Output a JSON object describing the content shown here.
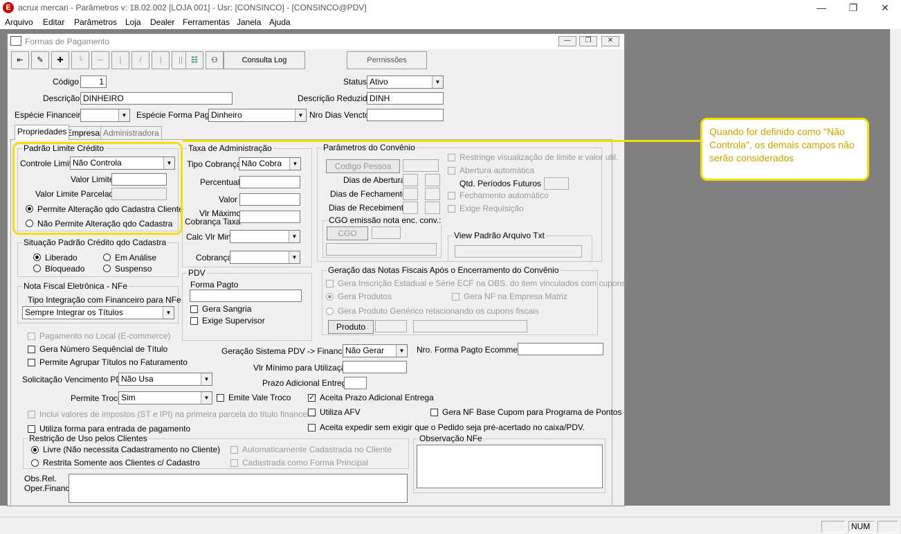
{
  "window": {
    "title": "acrux mercari - Parâmetros  v: 18.02.002   [LOJA 001]  - Usr: [CONSINCO] - [CONSINCO@PDV]",
    "app_icon": "E"
  },
  "menu": [
    "Arquivo",
    "Editar",
    "Parâmetros",
    "Loja",
    "Dealer",
    "Ferramentas",
    "Janela",
    "Ajuda"
  ],
  "child": {
    "title": "Formas de Pagamento"
  },
  "toolbar": {
    "consulta_log": "Consulta Log",
    "permissoes": "Permissões"
  },
  "header": {
    "codigo_label": "Código",
    "codigo": "1",
    "status_label": "Status",
    "status": "Ativo",
    "descricao_label": "Descrição",
    "descricao": "DINHEIRO",
    "desc_reduzida_label": "Descrição Reduzida",
    "desc_reduzida": "DINH",
    "especie_fin_label": "Espécie Financeira",
    "especie_fin": "",
    "especie_forma_label": "Espécie Forma Pagto",
    "especie_forma": "Dinheiro",
    "nro_dias_label": "Nro Dias Vencto",
    "nro_dias": ""
  },
  "tabs": [
    "Propriedades",
    "Empresas",
    "Administradora"
  ],
  "limite": {
    "title": "Padrão Limite Crédito",
    "controle_label": "Controle Limite",
    "controle": "Não Controla",
    "valor_label": "Valor Limite",
    "parcelado_label": "Valor Limite Parcelado",
    "opt1": "Permite Alteração qdo Cadastra Cliente",
    "opt2": "Não Permite Alteração qdo Cadastra"
  },
  "situacao": {
    "title": "Situação Padrão Crédito qdo Cadastra",
    "liberado": "Liberado",
    "analise": "Em Análise",
    "bloqueado": "Bloqueado",
    "suspenso": "Suspenso"
  },
  "nfe": {
    "title": "Nota Fiscal Eletrônica - NFe",
    "tipo_label": "Tipo Integração com Financeiro para NFe",
    "tipo": "Sempre Integrar os Títulos"
  },
  "taxa": {
    "title": "Taxa de Administração",
    "tipo_cob_label": "Tipo Cobrança",
    "tipo_cob": "Não Cobra",
    "percentual_label": "Percentual",
    "valor_label": "Valor",
    "vlr_max_label1": "Vlr Máximo",
    "vlr_max_label2": "Cobrança Taxa",
    "calc_label": "Calc Vlr Min",
    "cobranca_label": "Cobrança"
  },
  "pdv": {
    "title": "PDV",
    "forma_label": "Forma Pagto",
    "gera_sangria": "Gera Sangria",
    "exige_sup": "Exige Supervisor"
  },
  "convenio": {
    "title": "Parâmetros do Convênio",
    "codigo_pessoa": "Codigo Pessoa",
    "dias_abertura": "Dias de Abertura",
    "dias_fechamento": "Dias de Fechamento",
    "dias_recebimento": "Dias de Recebimento",
    "restringe": "Restringe visualização de limite e valor util.",
    "abertura_auto": "Abertura automática",
    "qtd_periodos": "Qtd. Períodos Futuros",
    "fechamento_auto": "Fechamento automático",
    "exige_req": "Exige Requisição",
    "cgo_title": "CGO emissão nota enc. conv.:",
    "cgo_btn": "CGO",
    "view_title": "View Padrão Arquivo Txt"
  },
  "geracao": {
    "title": "Geração das Notas Fiscais Após o Encerramento do Convênio",
    "gera_insc": "Gera Inscrição Estadual e Série ECF na OBS. do item vinculados com cupons",
    "gera_produtos": "Gera Produtos",
    "gera_nf_matriz": "Gera NF na Empresa Matriz",
    "gera_generico": "Gera Produto Genérico relacionando os cupons fiscais",
    "produto_btn": "Produto"
  },
  "opts": {
    "pag_local": "Pagamento no Local (E-commerce)",
    "gera_num": "Gera Número Sequêncial de Título",
    "permite_agrupar": "Permite Agrupar Títulos no Faturamento",
    "solic_label": "Solicitação Vencimento PDV",
    "solic": "Não Usa",
    "troco_label": "Permite Troco",
    "troco": "Sim",
    "emite_vale": "Emite Vale Troco",
    "inclui_impostos": "Inclui valores de impostos (ST e IPI) na primeira parcela do título financeiro",
    "utiliza_entrada": "Utiliza forma para entrada de pagamento",
    "geracao_pdv_label": "Geração Sistema PDV -> Financeiro",
    "geracao_pdv": "Não Gerar",
    "nro_forma_label": "Nro. Forma Pagto Ecommerce",
    "vlr_min_label": "Vlr Mínimo para Utilização",
    "prazo_label": "Prazo Adicional Entrega",
    "aceita_prazo": "Aceita Prazo Adicional Entrega",
    "utiliza_afv": "Utiliza AFV",
    "gera_nf_base": "Gera NF Base Cupom para Programa de Pontos",
    "aceita_expedir": "Aceita expedir sem exigir que o Pedido seja pré-acertado no caixa/PDV."
  },
  "restricao": {
    "title": "Restrição de Uso pelos Clientes",
    "livre": "Livre (Não necessita Cadastramento no Cliente)",
    "restrita": "Restrita Somente aos Clientes c/ Cadastro",
    "auto_cad": "Automaticamente Cadastrada no Cliente",
    "cad_principal": "Cadastrada como Forma Principal"
  },
  "obs": {
    "nfe_title": "Observação NFe",
    "rel_label1": "Obs.Rel.",
    "rel_label2": "Oper.Financ."
  },
  "callout": {
    "text": "Quando for definido como \"Não Controla\", os demais campos não serão considerados"
  },
  "status": {
    "num": "NUM"
  }
}
